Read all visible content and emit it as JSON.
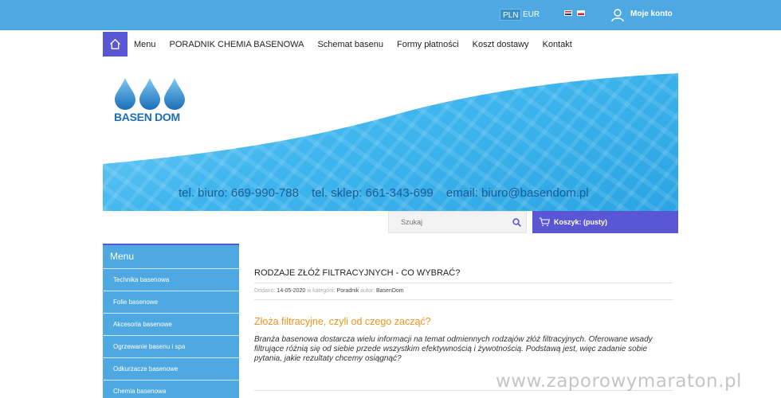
{
  "topbar": {
    "currencies": [
      "PLN",
      "EUR"
    ],
    "account_label": "Moje konto"
  },
  "nav": {
    "items": [
      "Menu",
      "PORADNIK CHEMIA BASENOWA",
      "Schemat basenu",
      "Formy płatności",
      "Koszt dostawy",
      "Kontakt"
    ]
  },
  "banner": {
    "logo_text": "BASEN DOM",
    "phone_office": "tel. biuro: 669-990-788",
    "phone_shop": "tel. sklep: 661-343-699",
    "email": "email: biuro@basendom.pl"
  },
  "search": {
    "placeholder": "Szukaj"
  },
  "cart": {
    "label": "Koszyk: (pusty)"
  },
  "sidebar": {
    "title": "Menu",
    "items": [
      "Technika basenowa",
      "Folie basenowe",
      "Akcesoria basenowe",
      "Ogrzewanie basenu i spa",
      "Odkurzacze basenowe",
      "Chemia basenowa"
    ]
  },
  "article": {
    "title": "RODZAJE ZŁÓŻ FILTRACYJNYCH - CO WYBRAĆ?",
    "meta_added_label": "Dodano:",
    "date": "14-05-2020",
    "meta_category_label": "w kategorii:",
    "category": "Poradnik",
    "meta_author_label": "autor:",
    "author": "BasenDom",
    "subheading": "Złoża filtracyjne, czyli od czego zacząć?",
    "paragraph": "Branża basenowa dostarcza wielu informacji na temat odmiennych rodzajów złóż filtracyjnych. Oferowane wsady filtrujące różnią się od siebie przede wszystkim efektywnością i żywotnością. Podstawą jest, więc zadanie sobie pytania, jakie rezultaty chcemy osiągnąć?"
  },
  "watermark": "www.zaporowymaraton.pl",
  "colors": {
    "topbar": "#4ea9e2",
    "accent": "#5957d6",
    "subheading": "#f0941c"
  }
}
